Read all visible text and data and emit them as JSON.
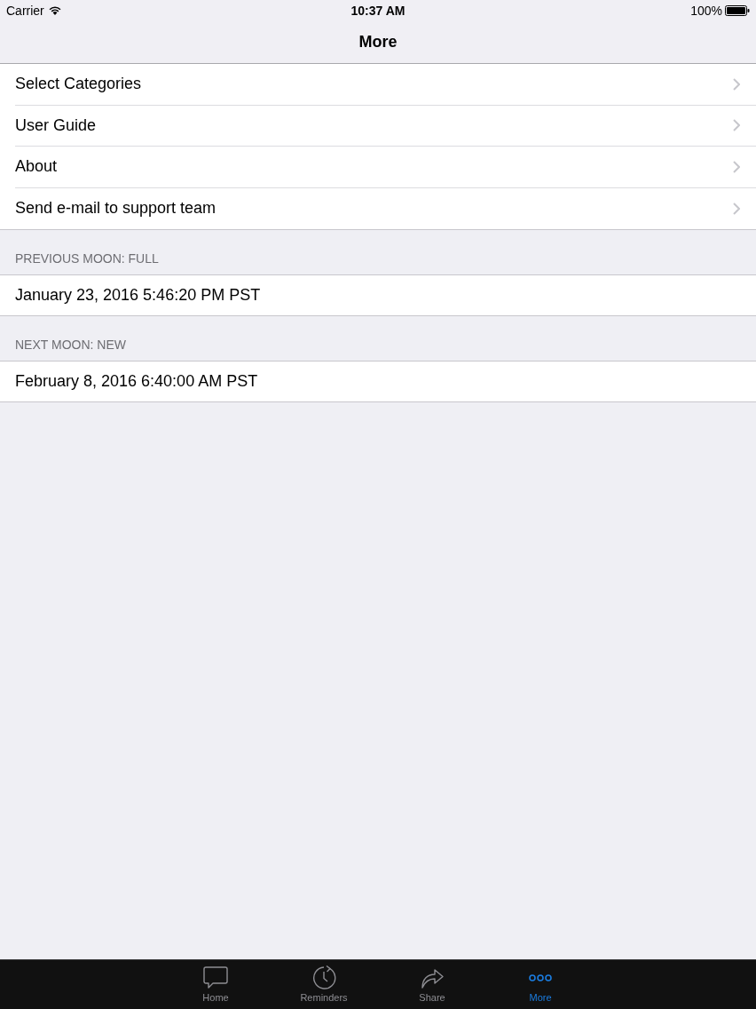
{
  "status_bar": {
    "carrier": "Carrier",
    "time": "10:37 AM",
    "battery": "100%"
  },
  "nav_bar": {
    "title": "More"
  },
  "menu": [
    {
      "label": "Select Categories"
    },
    {
      "label": "User Guide"
    },
    {
      "label": "About"
    },
    {
      "label": "Send e-mail to support team"
    }
  ],
  "sections": [
    {
      "header": "PREVIOUS MOON: FULL",
      "value": "January 23, 2016 5:46:20 PM PST"
    },
    {
      "header": "NEXT MOON: NEW",
      "value": "February 8, 2016 6:40:00 AM PST"
    }
  ],
  "tab_bar": [
    {
      "label": "Home",
      "kind": "chat",
      "selected": false
    },
    {
      "label": "Reminders",
      "kind": "clock",
      "selected": false
    },
    {
      "label": "Share",
      "kind": "share",
      "selected": false
    },
    {
      "label": "More",
      "kind": "more",
      "selected": true
    }
  ]
}
